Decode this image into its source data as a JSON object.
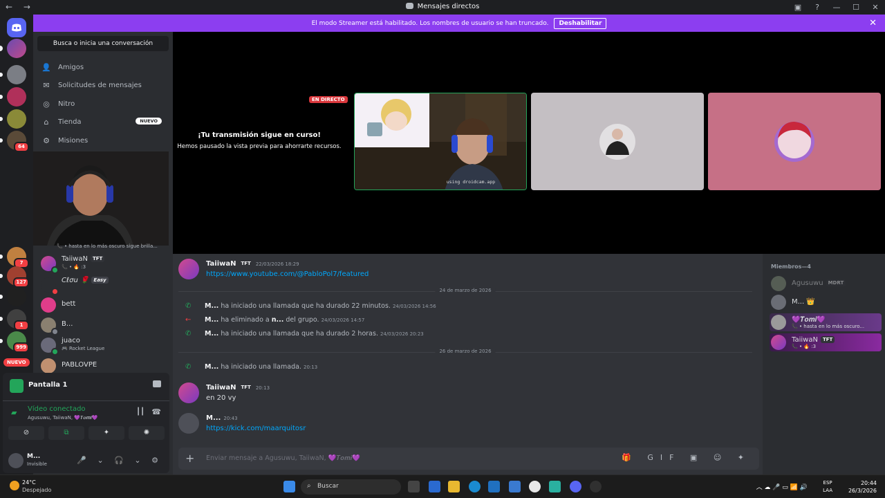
{
  "window": {
    "title": "Mensajes directos",
    "nav_arrows": "←  →",
    "controls": [
      "▣",
      "?",
      "—",
      "☐",
      "✕"
    ]
  },
  "banner": {
    "text": "El modo Streamer está habilitado. Los nombres de usuario se han truncado.",
    "button": "Deshabilitar",
    "close": "✕"
  },
  "guilds": {
    "badges": [
      "64",
      "7",
      "127",
      "1",
      "999"
    ],
    "new_label": "NUEVO"
  },
  "sidebar": {
    "search": "Busca o inicia una conversación",
    "nav": [
      {
        "label": "Amigos",
        "icon": "friends-icon"
      },
      {
        "label": "Solicitudes de mensajes",
        "icon": "mail-icon"
      },
      {
        "label": "Nitro",
        "icon": "nitro-icon"
      },
      {
        "label": "Tienda",
        "icon": "shop-icon",
        "badge": "NUEVO"
      },
      {
        "label": "Misiones",
        "icon": "quests-icon"
      }
    ],
    "partial_status": "• hasta en lo más oscuro sigue brilla...",
    "dms": [
      {
        "name": "TaiiwaN",
        "tag": "TFT",
        "sub": "📞 • 🔥 :3"
      },
      {
        "name": "Cℓσu 🌹",
        "tag": "Easy",
        "sub": ""
      },
      {
        "name": "bett",
        "tag": "",
        "sub": ""
      },
      {
        "name": "B...",
        "tag": "",
        "sub": ""
      },
      {
        "name": "juaco",
        "tag": "",
        "sub": "🎮 Rocket League"
      },
      {
        "name": "PABLOVPE",
        "tag": "",
        "sub": ""
      }
    ]
  },
  "voice_panel": {
    "screen_title": "Pantalla 1",
    "status": "Vídeo conectado",
    "participants": "Agusuwu, TaiiwaN, 💜𝑻𝒐𝒎𝒊💜",
    "buttons": [
      "⊘",
      "⧉",
      "✦",
      "✺"
    ],
    "user_name": "M...",
    "user_status": "Invisible",
    "controls": "🎤 ⌄ 🎧 ⌄ ⚙"
  },
  "stage": {
    "live_badge": "EN DIRECTO",
    "paused_title": "¡Tu transmisión sigue en curso!",
    "paused_desc": "Hemos pausado la vista previa para ahorrarte recursos.",
    "cam_overlay": "using droidcam.app"
  },
  "chat": {
    "messages": [
      {
        "author": "TaiiwaN",
        "tag": "TFT",
        "time": "22/03/2026 18:29",
        "body": "https://www.youtube.com/@PabloPol7/featured",
        "is_link": true
      }
    ],
    "divider1": "24 de marzo de 2026",
    "system1": [
      {
        "icon": "📞",
        "user": "M...",
        "text": "ha iniciado una llamada que ha durado 22 minutos.",
        "time": "24/03/2026 14:56"
      },
      {
        "icon": "←",
        "user": "M...",
        "text": "ha eliminado a",
        "target": "n...",
        "text2": "del grupo.",
        "time": "24/03/2026 14:57"
      },
      {
        "icon": "📞",
        "user": "M...",
        "text": "ha iniciado una llamada que ha durado 2 horas.",
        "time": "24/03/2026 20:23"
      }
    ],
    "divider2": "26 de marzo de 2026",
    "system2": {
      "icon": "📞",
      "user": "M...",
      "text": "ha iniciado una llamada.",
      "time": "20:13"
    },
    "msg2": {
      "author": "TaiiwaN",
      "tag": "TFT",
      "time": "20:13",
      "body": "en 20 vy"
    },
    "msg3": {
      "author": "M...",
      "time": "20:43",
      "body": "https://kick.com/maarquitosr"
    },
    "composer_placeholder": "Enviar mensaje a Agusuwu, TaiiwaN, 💜𝑻𝒐𝒎𝒊💜",
    "composer_icons": "🎁 GIF ▣ ☺ ✦"
  },
  "members": {
    "header": "Miembros—4",
    "list": [
      {
        "name": "Agusuwu",
        "tag": "MDRT",
        "sub": ""
      },
      {
        "name": "M... 👑",
        "tag": "",
        "sub": ""
      },
      {
        "name": "💜𝑻𝒐𝒎𝒊💜",
        "tag": "",
        "sub": "📞 • hasta en lo más oscuro..."
      },
      {
        "name": "TaiiwaN",
        "tag": "TFT",
        "sub": "📞 • 🔥 :3"
      }
    ]
  },
  "taskbar": {
    "temp": "24°C",
    "weather": "Despejado",
    "search": "Buscar",
    "lang1": "ESP",
    "lang2": "LAA",
    "time": "20:44",
    "date": "26/3/2026",
    "tray_icons": "︿  ☁  🎤  ▭  📶  🔊"
  },
  "colors": {
    "banner": "#8c3ef0",
    "link": "#00a8fc",
    "online": "#23a55a",
    "danger": "#f23f43"
  }
}
